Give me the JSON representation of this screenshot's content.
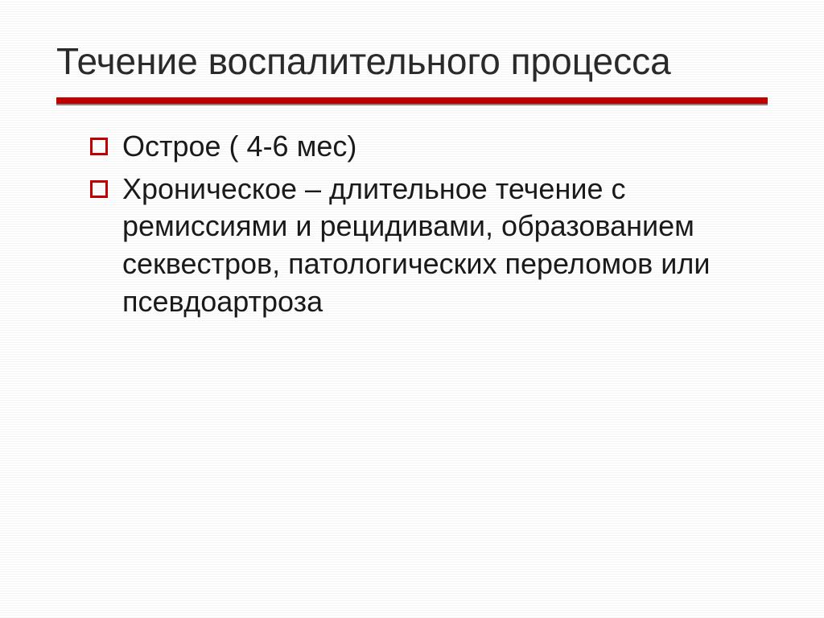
{
  "slide": {
    "title": "Течение воспалительного процесса",
    "accent_color": "#c00000",
    "bullets": [
      "Острое ( 4-6 мес)",
      "Хроническое – длительное течение с ремиссиями и рецидивами, образованием секвестров, патологических переломов или псевдоартроза"
    ]
  }
}
